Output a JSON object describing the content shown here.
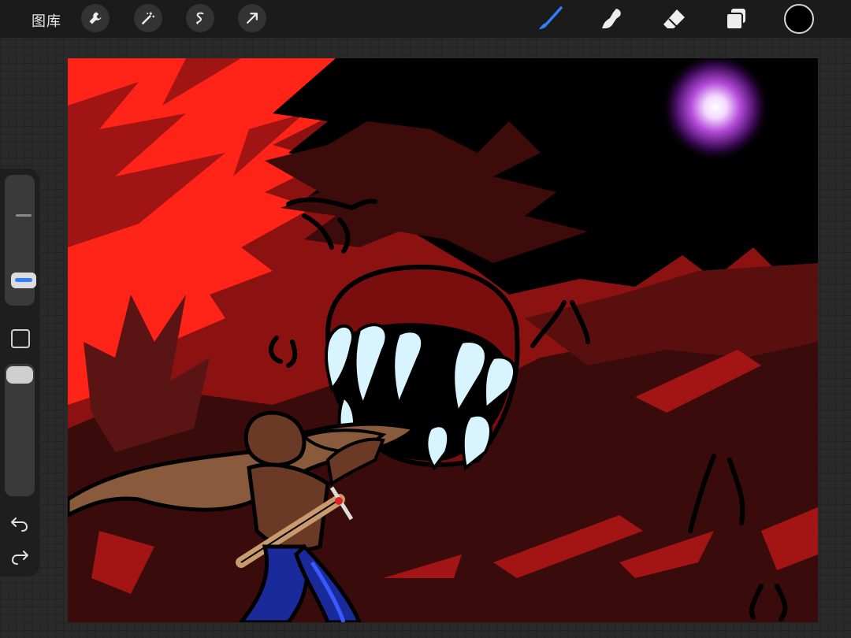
{
  "app": {
    "gallery_label": "图库"
  },
  "toolbar": {
    "left_tools": [
      "wrench-icon",
      "magic-wand-icon",
      "selection-icon",
      "transform-arrow-icon"
    ],
    "right_tools": [
      "brush-icon",
      "smudge-icon",
      "eraser-icon",
      "layers-icon"
    ],
    "active_tool": "brush",
    "active_color": "#000000",
    "accent_color": "#2f7fff"
  },
  "sidebar": {
    "brush_size_level": 0.55,
    "opacity_level": 0.95,
    "buttons": [
      "modify-square-icon",
      "undo-icon",
      "redo-icon"
    ]
  }
}
